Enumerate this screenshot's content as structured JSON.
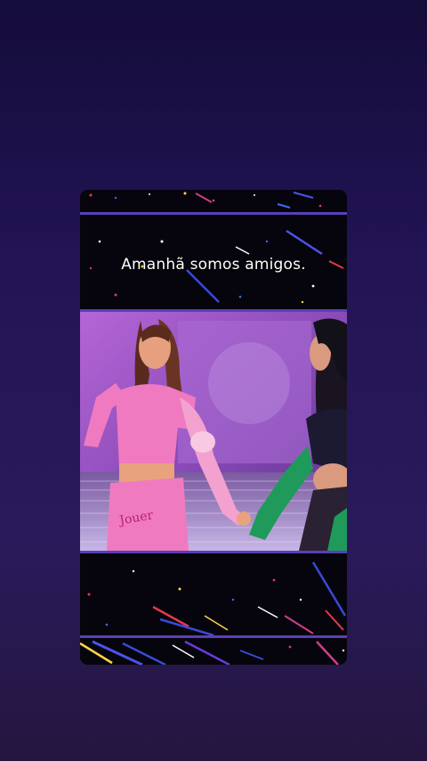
{
  "story": {
    "caption": "Amanhã somos amigos."
  },
  "colors": {
    "background_top": "#140c3a",
    "background_bottom": "#24163f",
    "divider": "#5a3fb8",
    "stage_purple": "#8a4bb8",
    "outfit_pink": "#f07ac0",
    "glove_green": "#1f9a5a"
  }
}
